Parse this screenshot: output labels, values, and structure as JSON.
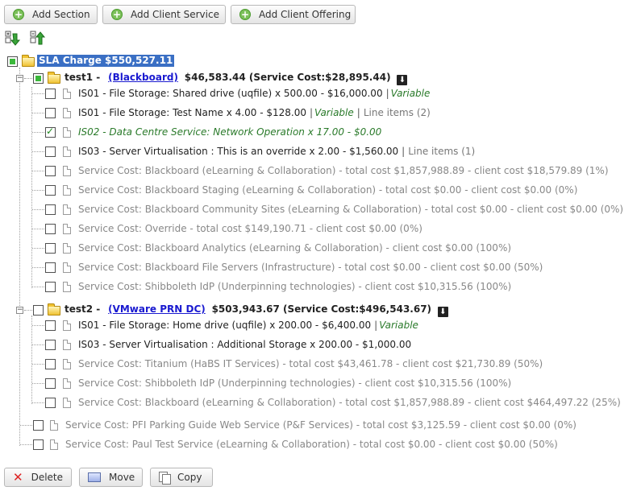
{
  "toolbar": {
    "add_section": "Add Section",
    "add_client_service": "Add Client Service",
    "add_client_offering": "Add Client Offering"
  },
  "tree": {
    "root_label": "SLA Charge $550,527.11",
    "test1": {
      "name": "test1 -",
      "link": "(Blackboard)",
      "summary": "$46,583.44 (Service Cost:$28,895.44)",
      "items": [
        {
          "text": "IS01 - File Storage: Shared drive (uqfile) x 500.00 - $16,000.00",
          "tag": "Variable",
          "lineitems": ""
        },
        {
          "text": "IS01 - File Storage: Test Name x 4.00 - $128.00",
          "tag": "Variable",
          "lineitems": "Line items (2)"
        },
        {
          "text": "IS02 - Data Centre Service: Network Operation x 17.00 - $0.00",
          "tag": "",
          "lineitems": ""
        },
        {
          "text": "IS03 - Server Virtualisation : This is an override x 2.00 - $1,560.00",
          "tag": "",
          "lineitems": "Line items (1)"
        },
        {
          "text": "Service Cost: Blackboard (eLearning & Collaboration) - total cost $1,857,988.89 - client cost $18,579.89 (1%)"
        },
        {
          "text": "Service Cost: Blackboard Staging (eLearning & Collaboration) - total cost $0.00 - client cost $0.00 (0%)"
        },
        {
          "text": "Service Cost: Blackboard Community Sites (eLearning & Collaboration) - total cost $0.00 - client cost $0.00 (0%)"
        },
        {
          "text": "Service Cost: Override - total cost $149,190.71 - client cost $0.00 (0%)"
        },
        {
          "text": "Service Cost: Blackboard Analytics (eLearning & Collaboration) - client cost $0.00 (100%)"
        },
        {
          "text": "Service Cost: Blackboard File Servers (Infrastructure) - total cost $0.00 - client cost $0.00 (50%)"
        },
        {
          "text": "Service Cost: Shibboleth IdP (Underpinning technologies) - client cost $10,315.56 (100%)"
        }
      ]
    },
    "test2": {
      "name": "test2 -",
      "link": "(VMware PRN DC)",
      "summary": "$503,943.67 (Service Cost:$496,543.67)",
      "items": [
        {
          "text": "IS01 - File Storage: Home drive (uqfile) x 200.00 - $6,400.00",
          "tag": "Variable"
        },
        {
          "text": "IS03 - Server Virtualisation : Additional Storage x 200.00 - $1,000.00",
          "tag": ""
        },
        {
          "text": "Service Cost: Titanium (HaBS IT Services) - total cost $43,461.78 - client cost $21,730.89 (50%)"
        },
        {
          "text": "Service Cost: Shibboleth IdP (Underpinning technologies) - client cost $10,315.56 (100%)"
        },
        {
          "text": "Service Cost: Blackboard (eLearning & Collaboration) - total cost $1,857,988.89 - client cost $464,497.22 (25%)"
        }
      ]
    },
    "root_items": [
      {
        "text": "Service Cost: PFI Parking Guide Web Service (P&F Services) - total cost $3,125.59 - client cost $0.00 (0%)"
      },
      {
        "text": "Service Cost: Paul Test Service (eLearning & Collaboration) - total cost $0.00 - client cost $0.00 (50%)"
      }
    ]
  },
  "separator": "|",
  "footer": {
    "delete": "Delete",
    "move": "Move",
    "copy": "Copy"
  }
}
